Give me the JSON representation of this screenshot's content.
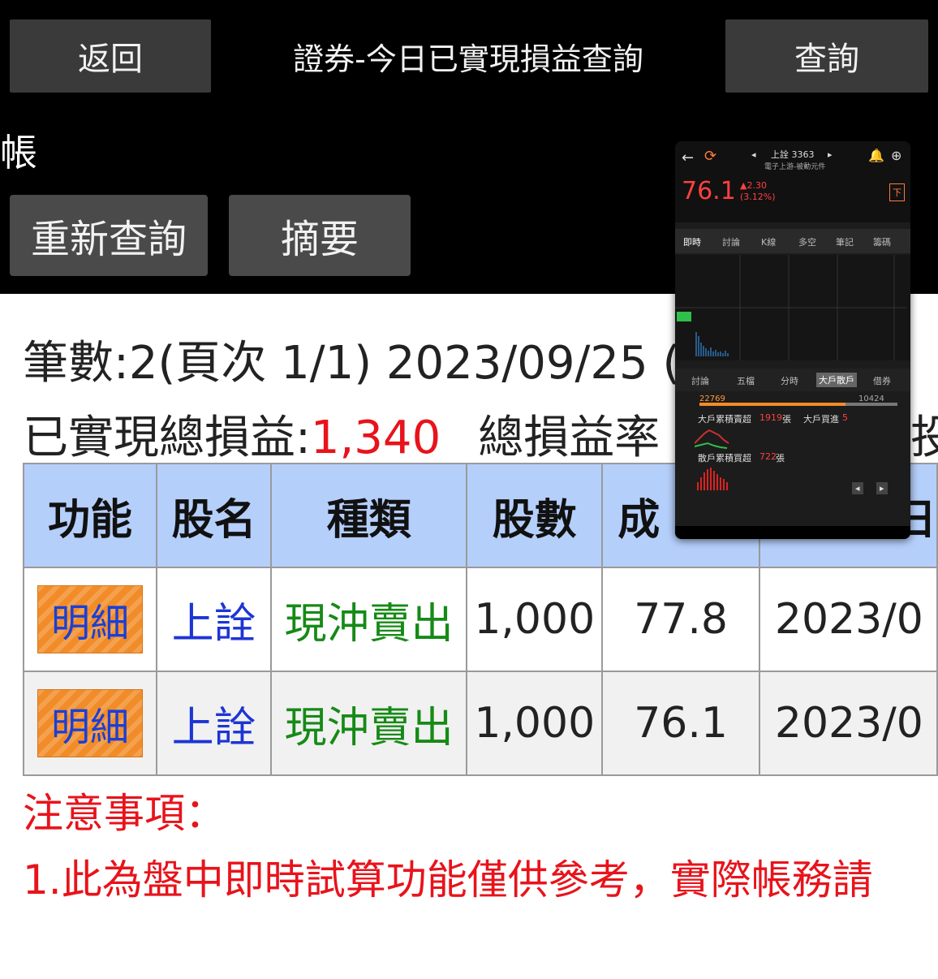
{
  "header": {
    "back_label": "返回",
    "title": "證券-今日已實現損益查詢",
    "query_label": "查詢",
    "account_label": "帳"
  },
  "actions": {
    "requery_label": "重新查詢",
    "summary_label": "摘要"
  },
  "info": {
    "count_text": "筆數:2(頁次 1/1) 2023/09/25 (",
    "total_label": "已實現總損益:",
    "total_value": "1,340",
    "rate_label": "總損益率",
    "invest_partial": "投"
  },
  "table": {
    "headers": [
      "功能",
      "股名",
      "種類",
      "股數",
      "成",
      "日"
    ],
    "rows": [
      {
        "func": "明細",
        "name": "上詮",
        "type": "現沖賣出",
        "shares": "1,000",
        "price": "77.8",
        "date": "2023/0"
      },
      {
        "func": "明細",
        "name": "上詮",
        "type": "現沖賣出",
        "shares": "1,000",
        "price": "76.1",
        "date": "2023/0"
      }
    ]
  },
  "notes": {
    "heading": "注意事項：",
    "line1": "1.此為盤中即時試算功能僅供參考，實際帳務請"
  },
  "overlay": {
    "stock": "上詮 3363",
    "sub": "電子上游-被動元件",
    "price": "76.1",
    "change": "▲2.30",
    "change_pct": "(3.12%)",
    "tabs": [
      "即時",
      "討論",
      "K線",
      "多空",
      "筆記",
      "籌碼"
    ],
    "tabs2": [
      "討論",
      "五檔",
      "分時",
      "大戶散戶",
      "借券"
    ],
    "big_buy_label": "大戶累積賣超",
    "big_buy_value": "1919",
    "big_unit": "張",
    "big_net_label": "大戶買進",
    "big_net_value": "5",
    "retail_label": "散戶累積買超",
    "retail_value": "722",
    "bar_left": "22769",
    "bar_right": "10424"
  },
  "colors": {
    "loss_red": "#e8131b",
    "header_blue": "#b5cffb",
    "detail_orange": "#f28c28",
    "link_blue": "#1d35d4",
    "type_green": "#168a16"
  }
}
